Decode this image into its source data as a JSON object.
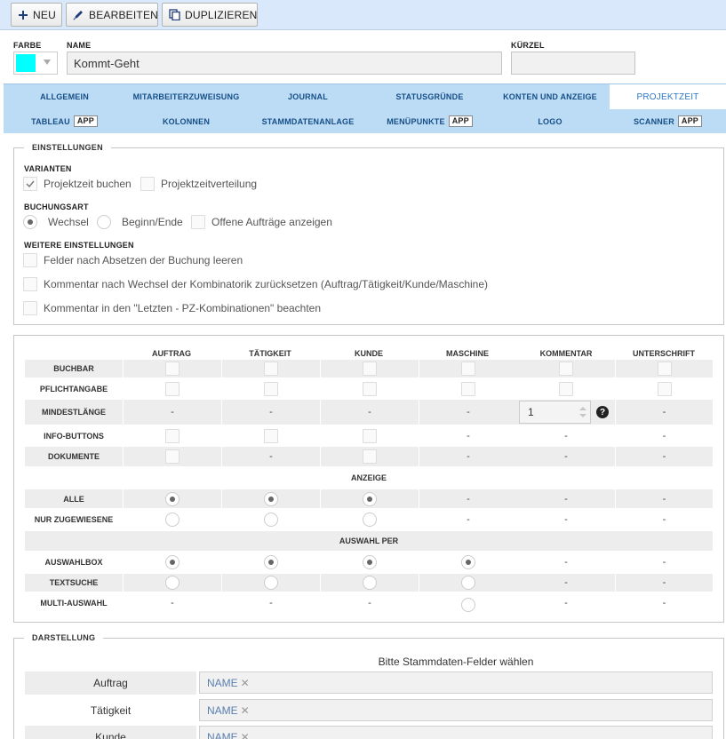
{
  "toolbar": {
    "new_label": "NEU",
    "edit_label": "BEARBEITEN",
    "duplicate_label": "DUPLIZIEREN"
  },
  "form": {
    "color_label": "FARBE",
    "color_value": "#00ffff",
    "name_label": "NAME",
    "name_value": "Kommt-Geht",
    "short_label": "KÜRZEL",
    "short_value": ""
  },
  "tabs": {
    "row1": [
      "ALLGEMEIN",
      "MITARBEITERZUWEISUNG",
      "JOURNAL",
      "STATUSGRÜNDE",
      "KONTEN UND ANZEIGE",
      "PROJEKTZEIT"
    ],
    "row2": [
      "TABLEAU",
      "KOLONNEN",
      "STAMMDATENANLAGE",
      "MENÜPUNKTE",
      "LOGO",
      "SCANNER"
    ],
    "active": "PROJEKTZEIT",
    "app_badge": "APP"
  },
  "settings": {
    "legend": "EINSTELLUNGEN",
    "variants_label": "VARIANTEN",
    "variant_options": [
      "Projektzeit buchen",
      "Projektzeitverteilung"
    ],
    "variant_checked": [
      true,
      false
    ],
    "booking_label": "BUCHUNGSART",
    "booking_options": [
      "Wechsel",
      "Beginn/Ende"
    ],
    "booking_selected": "Wechsel",
    "open_orders_label": "Offene Aufträge anzeigen",
    "more_label": "WEITERE EINSTELLUNGEN",
    "more_options": [
      "Felder nach Absetzen der Buchung leeren",
      "Kommentar nach Wechsel der Kombinatorik zurücksetzen (Auftrag/Tätigkeit/Kunde/Maschine)",
      "Kommentar in den \"Letzten - PZ-Kombinationen\" beachten"
    ]
  },
  "matrix": {
    "columns": [
      "AUFTRAG",
      "TÄTIGKEIT",
      "KUNDE",
      "MASCHINE",
      "KOMMENTAR",
      "UNTERSCHRIFT"
    ],
    "rows": {
      "bookable": "BUCHBAR",
      "mandatory": "PFLICHTANGABE",
      "min_length": "MINDESTLÄNGE",
      "info_buttons": "INFO-BUTTONS",
      "documents": "DOKUMENTE",
      "display_band": "ANZEIGE",
      "all": "ALLE",
      "assigned_only": "NUR ZUGEWIESENE",
      "select_band": "AUSWAHL PER",
      "select_box": "AUSWAHLBOX",
      "text_search": "TEXTSUCHE",
      "multi_select": "MULTI-AUSWAHL"
    },
    "dash": "-",
    "min_length_comment": "1"
  },
  "display": {
    "legend": "DARSTELLUNG",
    "hint": "Bitte Stammdaten-Felder wählen",
    "rows": [
      {
        "label": "Auftrag",
        "tag": "NAME"
      },
      {
        "label": "Tätigkeit",
        "tag": "NAME"
      },
      {
        "label": "Kunde",
        "tag": "NAME"
      }
    ]
  }
}
